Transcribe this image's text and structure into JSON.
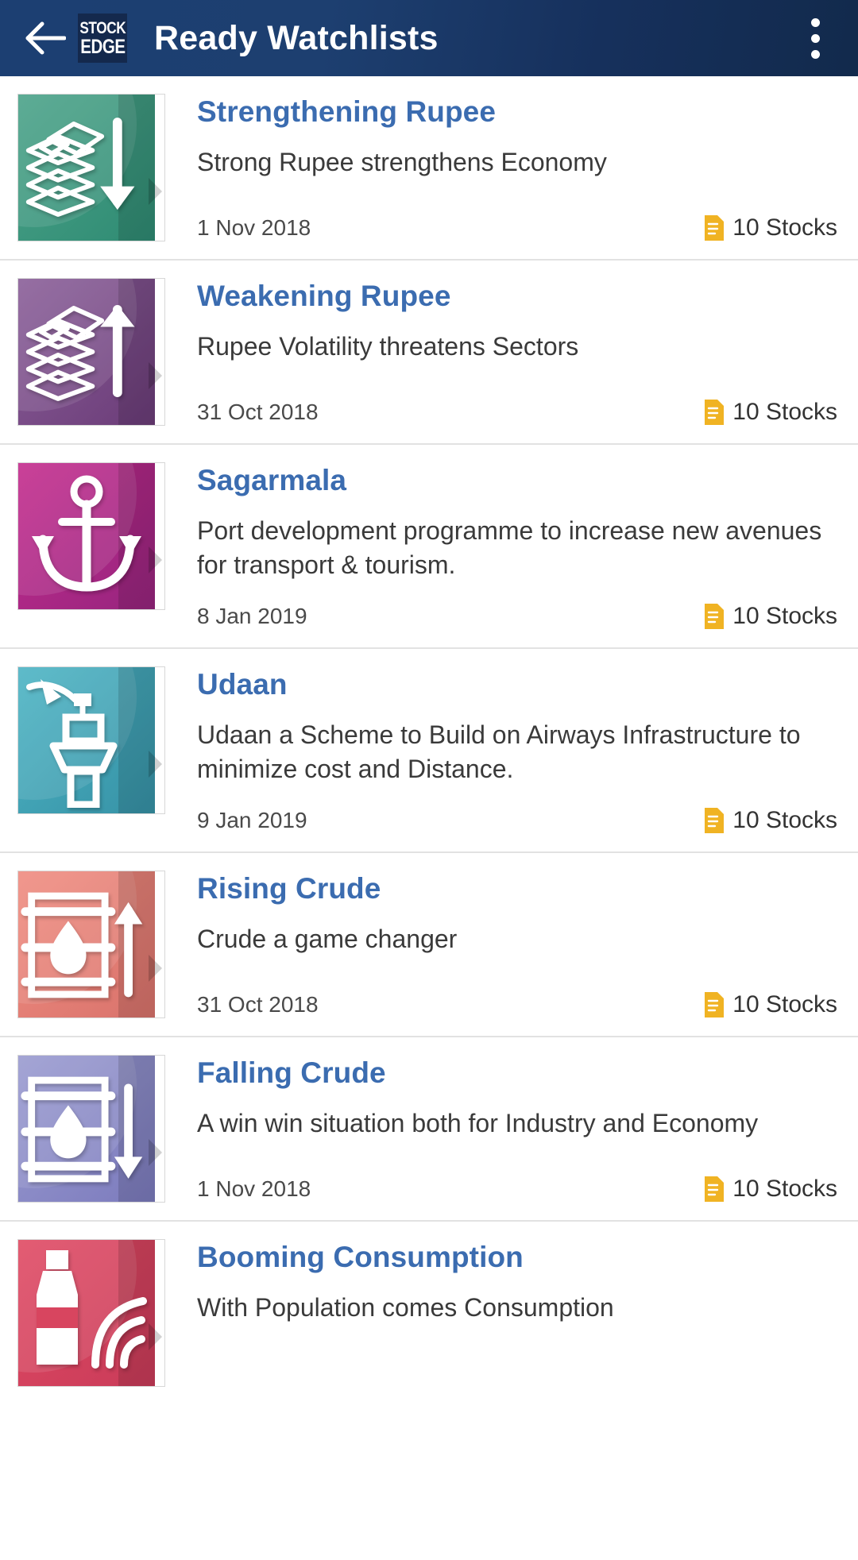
{
  "header": {
    "back_icon": "arrow-left-icon",
    "logo_line1": "STOCK",
    "logo_line2": "EDGE",
    "title": "Ready Watchlists",
    "overflow_icon": "more-vertical-icon"
  },
  "colors": {
    "appbar_start": "#1c3f72",
    "appbar_end": "#122a4c",
    "item_title": "#3b6cb0",
    "stocks_icon": "#f0b323",
    "divider": "#e2e2e2"
  },
  "stocks_icon_name": "document-icon",
  "items": [
    {
      "title": "Strengthening Rupee",
      "desc": "Strong Rupee strengthens Economy",
      "date": "1 Nov 2018",
      "stocks": "10 Stocks",
      "thumb_color_a": "#4ba389",
      "thumb_color_b": "#2f8b73",
      "art": "money-down-icon"
    },
    {
      "title": "Weakening Rupee",
      "desc": "Rupee Volatility threatens Sectors",
      "date": "31 Oct 2018",
      "stocks": "10 Stocks",
      "thumb_color_a": "#8a5f99",
      "thumb_color_b": "#6b3c78",
      "art": "money-up-icon"
    },
    {
      "title": "Sagarmala",
      "desc": "Port development programme to increase new avenues for transport & tourism.",
      "date": "8 Jan 2019",
      "stocks": "10 Stocks",
      "thumb_color_a": "#c42b8d",
      "thumb_color_b": "#96257e",
      "art": "anchor-icon"
    },
    {
      "title": "Udaan",
      "desc": "Udaan a Scheme to Build on Airways Infrastructure to minimize cost and Distance.",
      "date": "9 Jan 2019",
      "stocks": "10 Stocks",
      "thumb_color_a": "#4cb4c4",
      "thumb_color_b": "#3792a6",
      "art": "control-tower-icon"
    },
    {
      "title": "Rising Crude",
      "desc": "Crude a game changer",
      "date": "31 Oct 2018",
      "stocks": "10 Stocks",
      "thumb_color_a": "#f08c80",
      "thumb_color_b": "#d9736c",
      "art": "barrel-up-icon"
    },
    {
      "title": "Falling Crude",
      "desc": "A win win situation both for Industry and Economy",
      "date": "1 Nov 2018",
      "stocks": "10 Stocks",
      "thumb_color_a": "#9a9bd0",
      "thumb_color_b": "#7c7bbd",
      "art": "barrel-down-icon"
    },
    {
      "title": "Booming Consumption",
      "desc": "With Population comes Consumption",
      "date": "",
      "stocks": "",
      "thumb_color_a": "#e04a63",
      "thumb_color_b": "#c93b59",
      "art": "bottle-icon"
    }
  ]
}
